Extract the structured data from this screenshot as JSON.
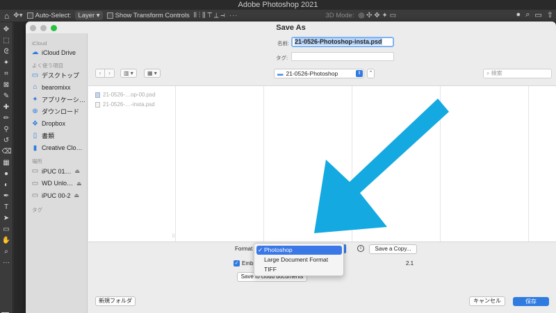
{
  "app": {
    "title": "Adobe Photoshop 2021"
  },
  "options_bar": {
    "home_icon": "home-icon",
    "auto_select_label": "Auto-Select:",
    "auto_select_value": "Layer",
    "show_transform_label": "Show Transform Controls",
    "mode_label": "3D Mode:",
    "dots": "···"
  },
  "dialog": {
    "title": "Save As",
    "name_label": "名前:",
    "name_value": "21-0526-Photoshop-insta.psd",
    "tags_label": "タグ:",
    "tags_value": "",
    "folder_name": "21-0526-Photoshop",
    "search_placeholder": "検索",
    "sidebar": {
      "sections": [
        {
          "title": "iCloud",
          "items": [
            {
              "label": "iCloud Drive",
              "icon": "cloud-icon",
              "eject": false
            }
          ]
        },
        {
          "title": "よく使う項目",
          "items": [
            {
              "label": "デスクトップ",
              "icon": "desktop-icon",
              "eject": false
            },
            {
              "label": "bearomixx",
              "icon": "home-folder-icon",
              "eject": false
            },
            {
              "label": "アプリケーシ…",
              "icon": "applications-icon",
              "eject": false
            },
            {
              "label": "ダウンロード",
              "icon": "download-icon",
              "eject": false
            },
            {
              "label": "Dropbox",
              "icon": "dropbox-icon",
              "eject": false
            },
            {
              "label": "書類",
              "icon": "document-icon",
              "eject": false
            },
            {
              "label": "Creative Clo…",
              "icon": "file-icon",
              "eject": false
            }
          ]
        },
        {
          "title": "場所",
          "items": [
            {
              "label": "iPUC 01…",
              "icon": "drive-icon",
              "eject": true
            },
            {
              "label": "WD Unlo…",
              "icon": "drive-icon",
              "eject": true
            },
            {
              "label": "iPUC 00-2",
              "icon": "drive-icon",
              "eject": true
            }
          ]
        },
        {
          "title": "タグ",
          "items": []
        }
      ]
    },
    "files": [
      {
        "label": "21-0526-…op-00.psd",
        "type": "psd"
      },
      {
        "label": "21-0526-…-insta.psd",
        "type": "doc"
      }
    ],
    "format_label": "Format",
    "format_options": [
      {
        "label": "Photoshop",
        "selected": true
      },
      {
        "label": "Large Document Format",
        "selected": false
      },
      {
        "label": "TIFF",
        "selected": false
      }
    ],
    "info_icon": "i",
    "save_copy_label": "Save a Copy...",
    "embed_label": "Emb",
    "embed_checked": true,
    "version_suffix": "2.1",
    "save_cloud_label": "Save to cloud documents",
    "new_folder_label": "新規フォルダ",
    "cancel_label": "キャンセル",
    "save_label": "保存"
  },
  "colors": {
    "accent": "#2f7be0",
    "arrow": "#14a9e0"
  }
}
